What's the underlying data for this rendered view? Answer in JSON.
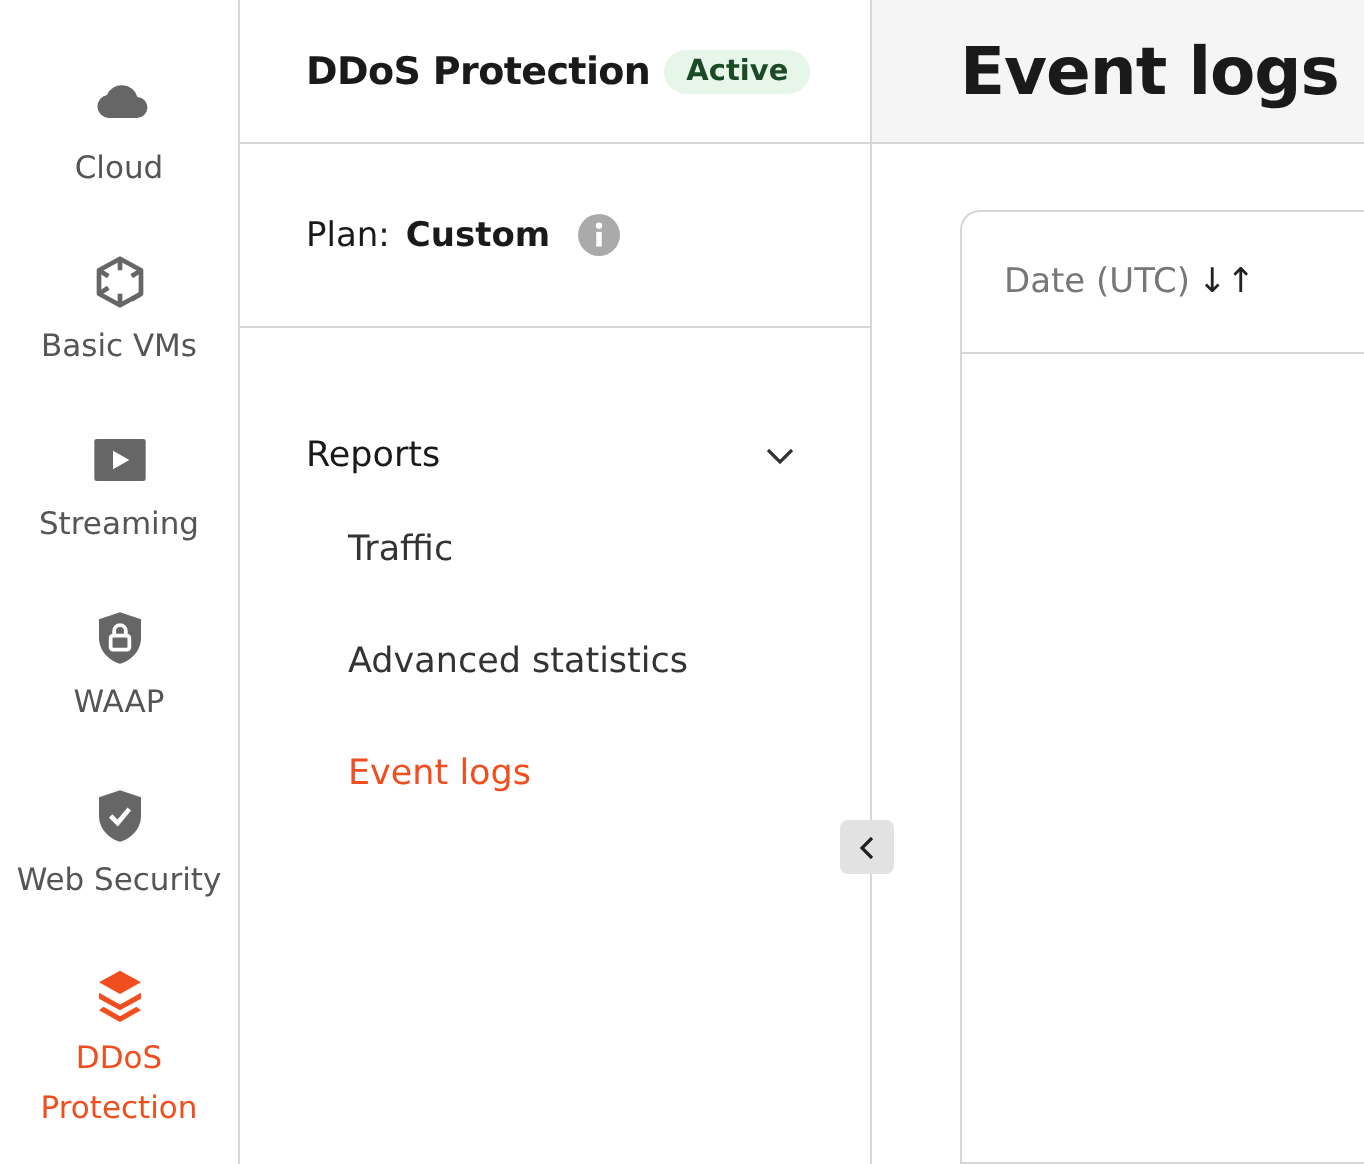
{
  "rail": {
    "items": [
      {
        "label": "Cloud",
        "kind": "cloud",
        "selected": false
      },
      {
        "label": "Basic VMs",
        "kind": "cube",
        "selected": false
      },
      {
        "label": "Streaming",
        "kind": "play",
        "selected": false
      },
      {
        "label": "WAAP",
        "kind": "lock",
        "selected": false
      },
      {
        "label": "Web Security",
        "kind": "check",
        "selected": false
      },
      {
        "label": "DDoS Protection",
        "kind": "layers",
        "selected": true
      }
    ]
  },
  "panel": {
    "title": "DDoS Protection",
    "status": "Active",
    "plan_label": "Plan:",
    "plan_value": "Custom",
    "section": {
      "label": "Reports",
      "expanded": true,
      "items": [
        {
          "label": "Traffic",
          "selected": false
        },
        {
          "label": "Advanced statistics",
          "selected": false
        },
        {
          "label": "Event logs",
          "selected": true
        }
      ]
    }
  },
  "main": {
    "title": "Event logs",
    "table": {
      "columns": [
        {
          "label": "Date (UTC)",
          "sort": "↓↑"
        }
      ]
    }
  }
}
